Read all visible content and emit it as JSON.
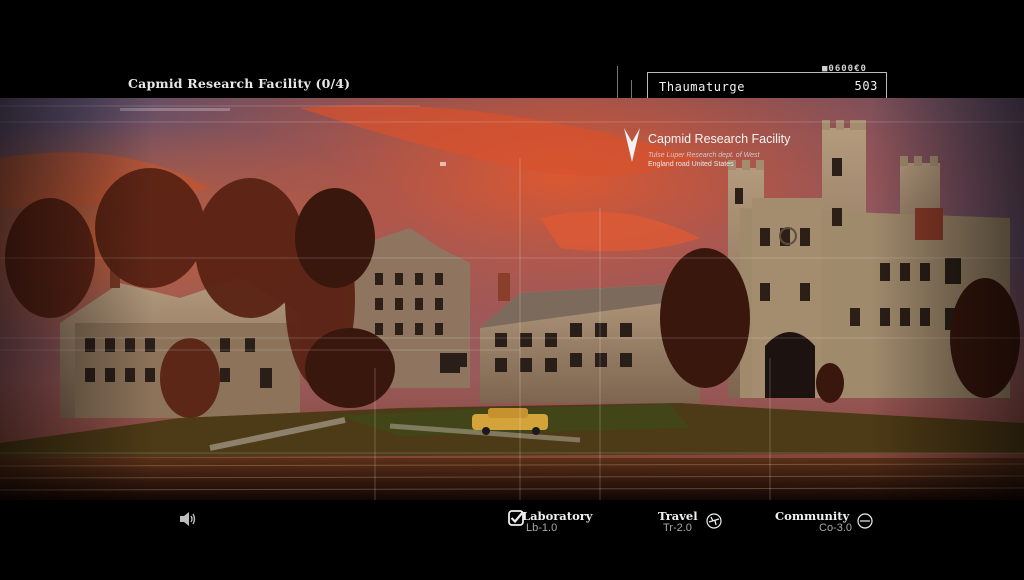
{
  "header": {
    "title": "Capmid Research Facility (0/4)",
    "user": {
      "name": "Thaumaturge",
      "score": "503"
    },
    "code_readout": "■0600€0"
  },
  "scene": {
    "facility_name": "Capmid Research Facility",
    "facility_sub1": "Tulse Luper Research dept. of West",
    "facility_sub2": "England road United States"
  },
  "nav": {
    "sound_icon": "speaker-icon",
    "items": [
      {
        "label": "Laboratory",
        "code": "Lb-1.0",
        "icon": "check-icon"
      },
      {
        "label": "Travel",
        "code": "Tr-2.0",
        "icon": "plane-icon"
      },
      {
        "label": "Community",
        "code": "Co-3.0",
        "icon": "globe-icon"
      }
    ]
  },
  "colors": {
    "background": "#000000",
    "sky_top": "#3b3a5c",
    "sky_glow": "#c0472a",
    "stone": "#9c8466",
    "foliage": "#4a1e12",
    "water": "#2a140c"
  }
}
